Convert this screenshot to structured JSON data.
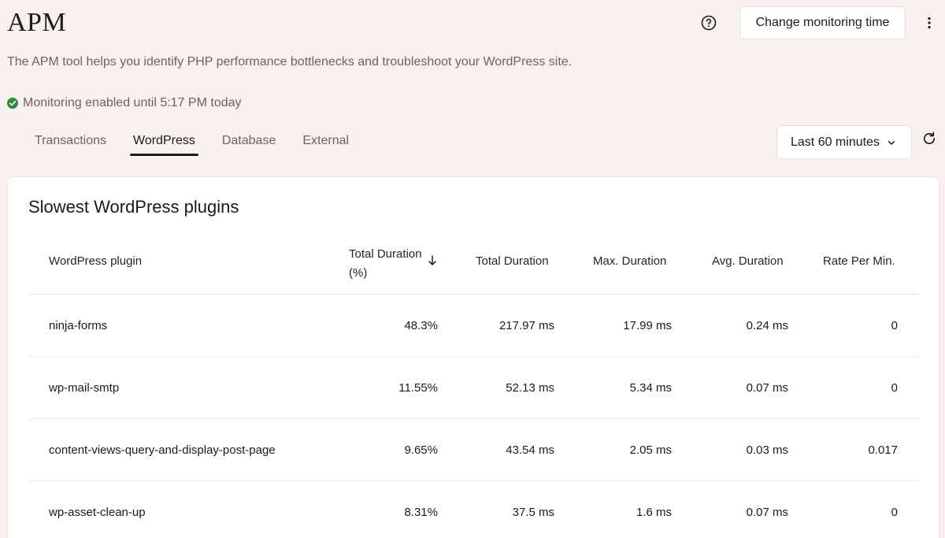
{
  "header": {
    "title": "APM",
    "help_icon": "help-circle-icon",
    "change_button": "Change monitoring time",
    "more_icon": "more-vertical-icon"
  },
  "description": "The APM tool helps you identify PHP performance bottlenecks and troubleshoot your WordPress site.",
  "status": {
    "icon": "check-circle-icon",
    "text": "Monitoring enabled until 5:17 PM today",
    "color": "#2f8a3b"
  },
  "tabs": [
    {
      "label": "Transactions",
      "active": false
    },
    {
      "label": "WordPress",
      "active": true
    },
    {
      "label": "Database",
      "active": false
    },
    {
      "label": "External",
      "active": false
    }
  ],
  "time_range": {
    "selected": "Last 60 minutes",
    "dropdown_icon": "chevron-down-icon",
    "refresh_icon": "refresh-icon"
  },
  "card": {
    "title": "Slowest WordPress plugins",
    "columns": {
      "plugin": "WordPress plugin",
      "total_pct": "Total Duration (%)",
      "total_duration": "Total Duration",
      "max_duration": "Max. Duration",
      "avg_duration": "Avg. Duration",
      "rate": "Rate Per Min."
    },
    "sort_icon": "arrow-down-icon",
    "rows": [
      {
        "plugin": "ninja-forms",
        "total_pct": "48.3%",
        "total_duration": "217.97 ms",
        "max_duration": "17.99 ms",
        "avg_duration": "0.24 ms",
        "rate": "0"
      },
      {
        "plugin": "wp-mail-smtp",
        "total_pct": "11.55%",
        "total_duration": "52.13 ms",
        "max_duration": "5.34 ms",
        "avg_duration": "0.07 ms",
        "rate": "0"
      },
      {
        "plugin": "content-views-query-and-display-post-page",
        "total_pct": "9.65%",
        "total_duration": "43.54 ms",
        "max_duration": "2.05 ms",
        "avg_duration": "0.03 ms",
        "rate": "0.017"
      },
      {
        "plugin": "wp-asset-clean-up",
        "total_pct": "8.31%",
        "total_duration": "37.5 ms",
        "max_duration": "1.6 ms",
        "avg_duration": "0.07 ms",
        "rate": "0"
      }
    ]
  }
}
